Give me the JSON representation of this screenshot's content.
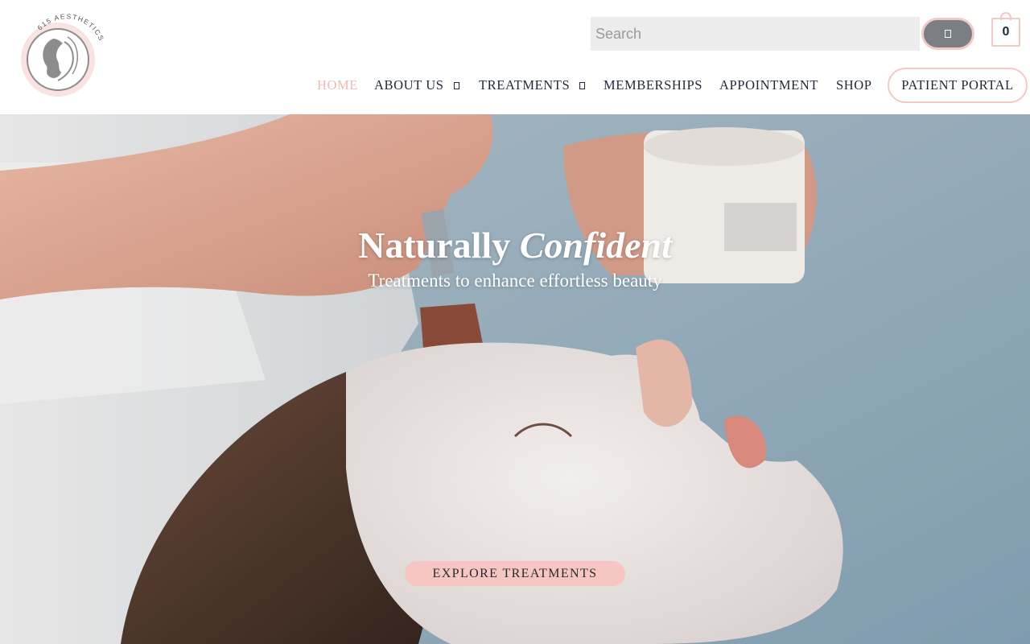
{
  "brand": {
    "logo_text": "615 AESTHETICS",
    "accent": "#f3c9c6",
    "nav_text": "#1e2a3a",
    "active_nav": "#f0b9b6"
  },
  "search": {
    "placeholder": "Search",
    "button_icon": "search-icon"
  },
  "cart": {
    "count": "0",
    "icon": "shopping-bag-icon"
  },
  "nav": {
    "items": [
      {
        "label": "HOME",
        "active": true
      },
      {
        "label": "ABOUT US",
        "has_dropdown": true
      },
      {
        "label": "TREATMENTS",
        "has_dropdown": true
      },
      {
        "label": "MEMBERSHIPS"
      },
      {
        "label": "APPOINTMENT"
      },
      {
        "label": "SHOP"
      }
    ],
    "portal_label": "PATIENT PORTAL"
  },
  "hero": {
    "title_plain": "Naturally ",
    "title_italic": "Confident",
    "subtitle": "Treatments to enhance effortless beauty",
    "cta_label": "EXPLORE TREATMENTS"
  }
}
